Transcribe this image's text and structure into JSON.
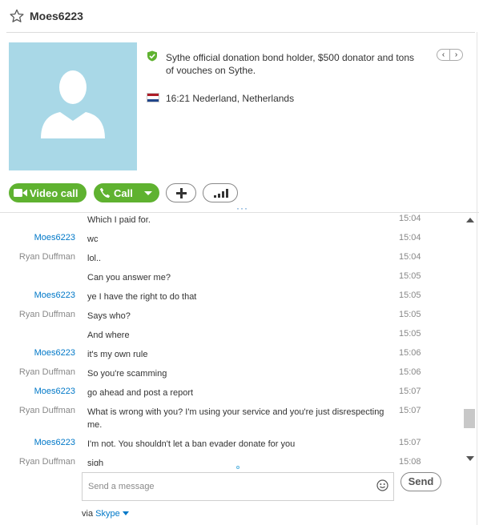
{
  "header": {
    "contact_name": "Moes6223",
    "star_icon": "star-outline-icon"
  },
  "profile": {
    "mood_message": "Sythe official donation bond holder, $500 donator and tons of vouches on Sythe.",
    "location_time": "16:21 Nederland, Netherlands",
    "flag_colors": [
      "#ae1c28",
      "#ffffff",
      "#21468b"
    ],
    "avatar_bg": "#a9d8e7"
  },
  "nav": {
    "prev_label": "‹",
    "next_label": "›"
  },
  "actions": {
    "video_call_label": "Video call",
    "call_label": "Call",
    "accent_green": "#5fb230"
  },
  "more_indicator": "···",
  "chat": {
    "messages": [
      {
        "sender": "",
        "text": "Which I paid for.",
        "time": "15:04",
        "self": false
      },
      {
        "sender": "Moes6223",
        "text": "wc",
        "time": "15:04",
        "self": true
      },
      {
        "sender": "Ryan Duffman",
        "text": "lol..",
        "time": "15:04",
        "self": false
      },
      {
        "sender": "",
        "text": "Can you answer me?",
        "time": "15:05",
        "self": false
      },
      {
        "sender": "Moes6223",
        "text": "ye I have the right to do that",
        "time": "15:05",
        "self": true
      },
      {
        "sender": "Ryan Duffman",
        "text": "Says who?",
        "time": "15:05",
        "self": false
      },
      {
        "sender": "",
        "text": "And where",
        "time": "15:05",
        "self": false
      },
      {
        "sender": "Moes6223",
        "text": "it's my own rule",
        "time": "15:06",
        "self": true
      },
      {
        "sender": "Ryan Duffman",
        "text": "So you're scamming",
        "time": "15:06",
        "self": false
      },
      {
        "sender": "Moes6223",
        "text": "go ahead and post a report",
        "time": "15:07",
        "self": true
      },
      {
        "sender": "Ryan Duffman",
        "text": "What is wrong with you? I'm using your service and you're just disrespecting me.",
        "time": "15:07",
        "self": false
      },
      {
        "sender": "Moes6223",
        "text": "I'm not. You shouldn't let a ban evader donate for you",
        "time": "15:07",
        "self": true
      },
      {
        "sender": "Ryan Duffman",
        "text": "sigh",
        "time": "15:08",
        "self": false
      }
    ],
    "sender_color_self": "#0078c8",
    "sender_color_other": "#888888"
  },
  "composer": {
    "placeholder": "Send a message",
    "value": "",
    "send_label": "Send",
    "via_prefix": "via ",
    "via_service": "Skype"
  }
}
